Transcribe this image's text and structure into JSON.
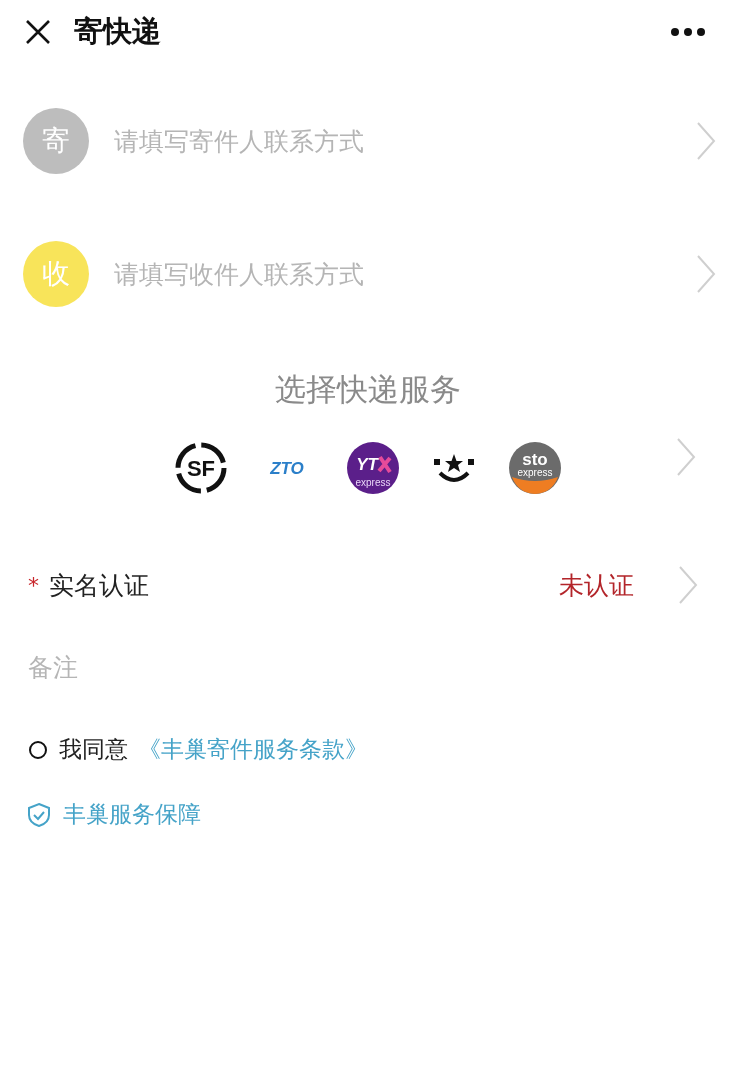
{
  "header": {
    "title": "寄快递"
  },
  "contacts": [
    {
      "badge": "寄",
      "color": "#bdbdbd",
      "placeholder": "请填写寄件人联系方式"
    },
    {
      "badge": "收",
      "color": "#f8e45a",
      "placeholder": "请填写收件人联系方式"
    }
  ],
  "service": {
    "title": "选择快递服务",
    "carriers": [
      {
        "kind": "sf",
        "text": "SF"
      },
      {
        "kind": "zto",
        "text": "ZTO"
      },
      {
        "kind": "yto",
        "text": "YT",
        "sub": "express"
      },
      {
        "kind": "star"
      },
      {
        "kind": "sto",
        "text": "sto",
        "sub": "express"
      }
    ]
  },
  "verification": {
    "required_mark": "*",
    "label": "实名认证",
    "status": "未认证"
  },
  "note": {
    "placeholder": "备注"
  },
  "agreement": {
    "checked": false,
    "prefix": "我同意",
    "link": "《丰巢寄件服务条款》"
  },
  "guarantee": {
    "label": "丰巢服务保障"
  }
}
